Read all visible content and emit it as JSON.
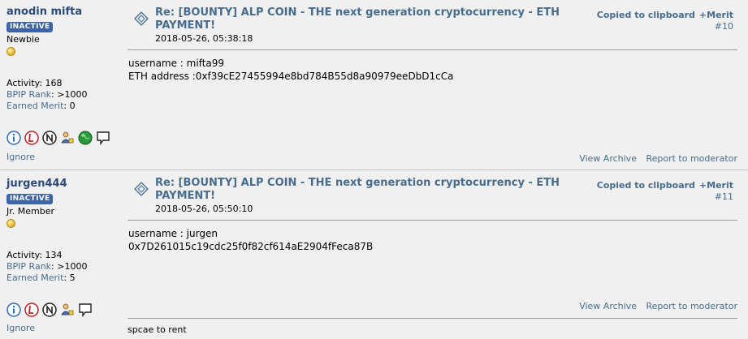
{
  "posts": [
    {
      "username": "anodin mifta",
      "status_badge": "INACTIVE",
      "rank": "Newbie",
      "activity": "Activity: 168",
      "bpip_label": "BPIP Rank",
      "bpip_value": ": >1000",
      "merit_label": "Earned Merit",
      "merit_value": ": 0",
      "subject": "Re: [BOUNTY] ALP COIN - THE next generation cryptocurrency - ETH PAYMENT!",
      "date": "2018-05-26, 05:38:18",
      "copied": "Copied to clipboard",
      "merit_button": "+Merit",
      "post_number": "#10",
      "body_lines": [
        "username : mifta99",
        "ETH address :0xf39cE27455994e8bd784B55d8a90979eeDbD1cCa"
      ],
      "view_archive": "View Archive",
      "report": "Report to moderator",
      "ignore": "Ignore",
      "signature": ""
    },
    {
      "username": "jurgen444",
      "status_badge": "INACTIVE",
      "rank": "Jr. Member",
      "activity": "Activity: 134",
      "bpip_label": "BPIP Rank",
      "bpip_value": ": >1000",
      "merit_label": "Earned Merit",
      "merit_value": ": 5",
      "subject": "Re: [BOUNTY] ALP COIN - THE next generation cryptocurrency - ETH PAYMENT!",
      "date": "2018-05-26, 05:50:10",
      "copied": "Copied to clipboard",
      "merit_button": "+Merit",
      "post_number": "#11",
      "body_lines": [
        "username : jurgen",
        "0x7D261015c19cdc25f0f82cf614aE2904fFeca87B"
      ],
      "view_archive": "View Archive",
      "report": "Report to moderator",
      "ignore": "Ignore",
      "signature": "spcae to rent"
    }
  ],
  "colors": {
    "link": "#476c8e",
    "username": "#2a4a7a",
    "badge": "#3c64a8",
    "background": "#f0f0f0"
  },
  "icons": [
    "info-icon",
    "ignore-list-icon",
    "no-pm-icon",
    "user-trust-icon",
    "globe-icon",
    "message-icon"
  ]
}
